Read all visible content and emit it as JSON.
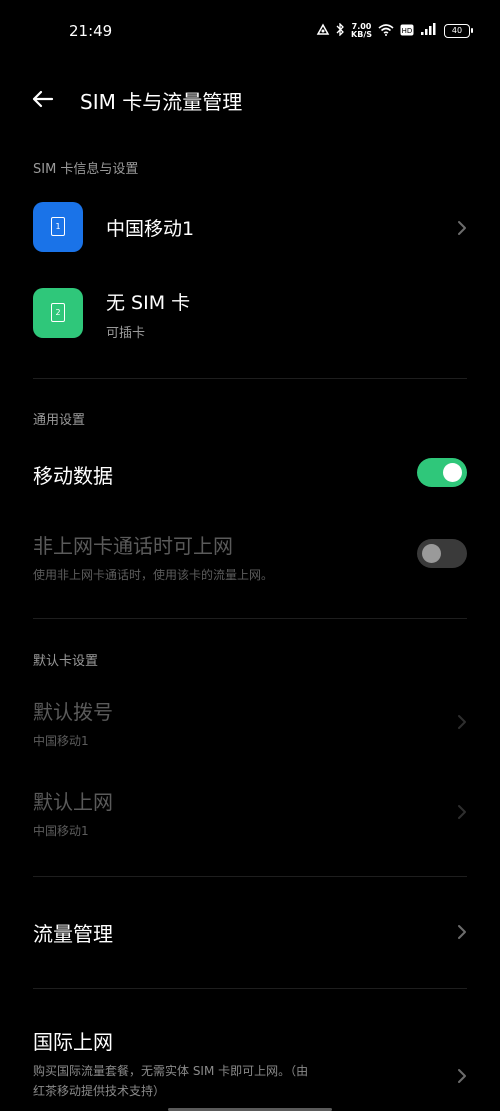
{
  "status_bar": {
    "time": "21:49",
    "net_speed_value": "7.00",
    "net_speed_unit": "KB/S",
    "battery": "40"
  },
  "header": {
    "title": "SIM 卡与流量管理"
  },
  "sim_section": {
    "title": "SIM 卡信息与设置",
    "sims": [
      {
        "slot": "1",
        "name": "中国移动1",
        "subtitle": "",
        "color": "#1a73e8"
      },
      {
        "slot": "2",
        "name": "无 SIM 卡",
        "subtitle": "可插卡",
        "color": "#2fc77a"
      }
    ]
  },
  "general_section": {
    "title": "通用设置",
    "mobile_data": {
      "label": "移动数据",
      "enabled": true
    },
    "non_data_call": {
      "label": "非上网卡通话时可上网",
      "subtitle": "使用非上网卡通话时，使用该卡的流量上网。",
      "enabled": false
    }
  },
  "default_section": {
    "title": "默认卡设置",
    "dial": {
      "label": "默认拨号",
      "value": "中国移动1"
    },
    "data": {
      "label": "默认上网",
      "value": "中国移动1"
    }
  },
  "traffic": {
    "label": "流量管理"
  },
  "international": {
    "label": "国际上网",
    "subtitle_line1": "购买国际流量套餐，无需实体 SIM 卡即可上网。（由",
    "subtitle_line2": "红茶移动提供技术支持）"
  },
  "colors": {
    "accent": "#2fc77a",
    "sim1": "#1a73e8",
    "sim2": "#2fc77a",
    "toggle_off": "#3a3a3a"
  }
}
